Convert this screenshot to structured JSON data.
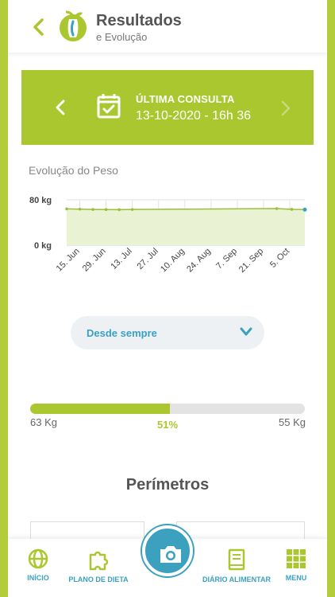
{
  "header": {
    "title": "Resultados",
    "subtitle": "e Evolução"
  },
  "banner": {
    "label": "ÚLTIMA CONSULTA",
    "date": "13-10-2020 - 16h 36"
  },
  "chart_section_title": "Evolução do Peso",
  "chart_data": {
    "type": "area",
    "title": "",
    "xlabel": "",
    "ylabel": "",
    "ylim": [
      0,
      80
    ],
    "y_tick_labels": [
      "80 kg",
      "0 kg"
    ],
    "x_tick_labels": [
      "15. Jun",
      "29. Jun",
      "13. Jul",
      "27. Jul",
      "10. Aug",
      "24. Aug",
      "7. Sep",
      "21. Sep",
      "5. Oct"
    ],
    "series": [
      {
        "x": [
          "2020-06-08",
          "2020-06-15",
          "2020-06-22",
          "2020-06-29",
          "2020-07-06",
          "2020-07-13",
          "2020-09-28",
          "2020-10-06",
          "2020-10-13"
        ],
        "values": [
          64,
          63.5,
          63,
          62.8,
          62.6,
          62.9,
          64.5,
          63.2,
          62.7
        ]
      }
    ],
    "grid": true,
    "line_color": "#9bbf3a",
    "fill_color": "#eaf2d4",
    "last_point_color": "#3aa1c2"
  },
  "period_filter": {
    "value": "Desde sempre"
  },
  "progress": {
    "start": "63 Kg",
    "percent_label": "51%",
    "target": "55 Kg",
    "fraction": 0.51
  },
  "section_title": "Perímetros",
  "nav": {
    "inicio": "INÍCIO",
    "plano": "PLANO DE DIETA",
    "diario": "DIÁRIO ALIMENTAR",
    "menu": "MENU"
  },
  "colors": {
    "brand_green": "#aac72f",
    "accent_blue": "#3aa1c2"
  }
}
